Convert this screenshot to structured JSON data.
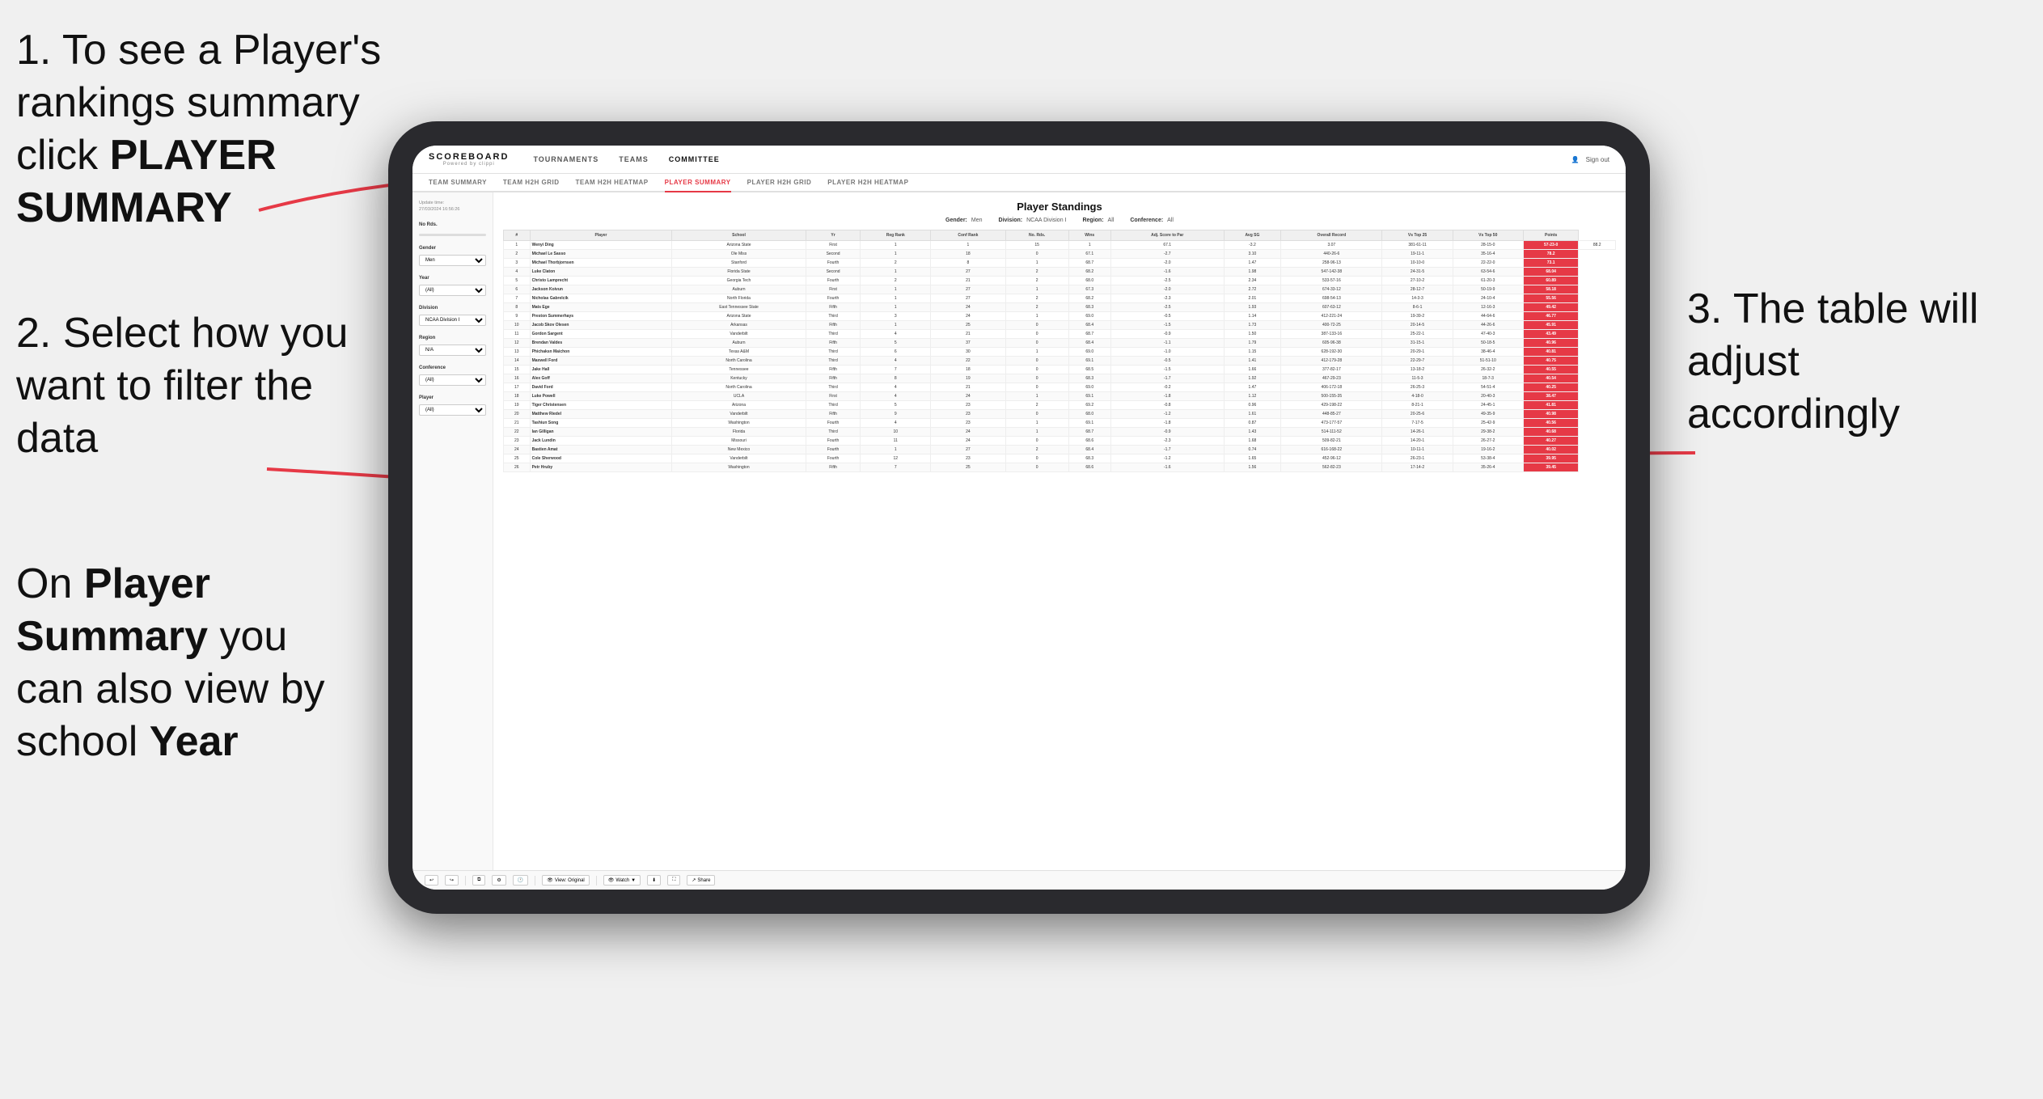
{
  "instructions": {
    "step1": {
      "text_prefix": "1. To see a Player's rankings summary click ",
      "bold_text": "PLAYER SUMMARY",
      "number": "1."
    },
    "step2": {
      "text": "2. Select how you want to filter the data"
    },
    "step3": {
      "text_prefix": "On ",
      "bold1": "Player Summary",
      "text_mid": " you can also view by school ",
      "bold2": "Year"
    },
    "step4": {
      "text": "3. The table will adjust accordingly"
    }
  },
  "app": {
    "logo": "SCOREBOARD",
    "logo_sub": "Powered by clippi",
    "nav": [
      "TOURNAMENTS",
      "TEAMS",
      "COMMITTEE"
    ],
    "nav_right": [
      "Sign out"
    ],
    "subnav": [
      "TEAM SUMMARY",
      "TEAM H2H GRID",
      "TEAM H2H HEATMAP",
      "PLAYER SUMMARY",
      "PLAYER H2H GRID",
      "PLAYER H2H HEATMAP"
    ],
    "active_subnav": "PLAYER SUMMARY"
  },
  "sidebar": {
    "update_label": "Update time:",
    "update_time": "27/03/2024 16:56:26",
    "no_rds_label": "No Rds.",
    "gender_label": "Gender",
    "gender_value": "Men",
    "year_label": "Year",
    "year_value": "(All)",
    "division_label": "Division",
    "division_value": "NCAA Division I",
    "region_label": "Region",
    "region_value": "N/A",
    "conference_label": "Conference",
    "conference_value": "(All)",
    "player_label": "Player",
    "player_value": "(All)"
  },
  "table": {
    "title": "Player Standings",
    "filters": {
      "gender_label": "Gender:",
      "gender_value": "Men",
      "division_label": "Division:",
      "division_value": "NCAA Division I",
      "region_label": "Region:",
      "region_value": "All",
      "conference_label": "Conference:",
      "conference_value": "All"
    },
    "columns": [
      "#",
      "Player",
      "School",
      "Yr",
      "Reg Rank",
      "Conf Rank",
      "No. Rds.",
      "Wins",
      "Adj. Score to Par",
      "Avg SG",
      "Overall Record",
      "Vs Top 25",
      "Vs Top 50",
      "Points"
    ],
    "rows": [
      [
        "1",
        "Wenyi Ding",
        "Arizona State",
        "First",
        "1",
        "1",
        "15",
        "1",
        "67.1",
        "-3.2",
        "3.07",
        "381-61-11",
        "28-15-0",
        "57-23-0",
        "88.2"
      ],
      [
        "2",
        "Michael Le Sasso",
        "Ole Miss",
        "Second",
        "1",
        "18",
        "0",
        "67.1",
        "-2.7",
        "3.10",
        "440-26-6",
        "19-11-1",
        "35-16-4",
        "78.2"
      ],
      [
        "3",
        "Michael Thorbjornsen",
        "Stanford",
        "Fourth",
        "2",
        "8",
        "1",
        "68.7",
        "-2.0",
        "1.47",
        "258-96-13",
        "10-10-0",
        "22-22-0",
        "73.1"
      ],
      [
        "4",
        "Luke Claton",
        "Florida State",
        "Second",
        "1",
        "27",
        "2",
        "68.2",
        "-1.6",
        "1.98",
        "547-142-38",
        "24-31-5",
        "63-54-6",
        "68.04"
      ],
      [
        "5",
        "Christo Lamprecht",
        "Georgia Tech",
        "Fourth",
        "2",
        "21",
        "2",
        "68.0",
        "-2.5",
        "2.34",
        "533-57-16",
        "27-10-2",
        "61-20-3",
        "60.89"
      ],
      [
        "6",
        "Jackson Koivun",
        "Auburn",
        "First",
        "1",
        "27",
        "1",
        "67.3",
        "-2.0",
        "2.72",
        "674-33-12",
        "28-12-7",
        "50-19-9",
        "58.18"
      ],
      [
        "7",
        "Nicholas Gabrelcik",
        "North Florida",
        "Fourth",
        "1",
        "27",
        "2",
        "68.2",
        "-2.3",
        "2.01",
        "698-54-13",
        "14-3-3",
        "24-10-4",
        "55.56"
      ],
      [
        "8",
        "Mats Ege",
        "East Tennessee State",
        "Fifth",
        "1",
        "24",
        "2",
        "68.3",
        "-2.5",
        "1.93",
        "607-63-12",
        "8-6-1",
        "12-16-3",
        "49.42"
      ],
      [
        "9",
        "Preston Summerhays",
        "Arizona State",
        "Third",
        "3",
        "24",
        "1",
        "69.0",
        "-0.5",
        "1.14",
        "412-221-24",
        "19-39-2",
        "44-64-6",
        "46.77"
      ],
      [
        "10",
        "Jacob Skov Olesen",
        "Arkansas",
        "Fifth",
        "1",
        "25",
        "0",
        "68.4",
        "-1.5",
        "1.73",
        "400-72-25",
        "20-14-5",
        "44-26-6",
        "45.91"
      ],
      [
        "11",
        "Gordon Sargent",
        "Vanderbilt",
        "Third",
        "4",
        "21",
        "0",
        "68.7",
        "-0.9",
        "1.50",
        "387-133-16",
        "25-22-1",
        "47-40-3",
        "43.49"
      ],
      [
        "12",
        "Brendan Valdes",
        "Auburn",
        "Fifth",
        "5",
        "37",
        "0",
        "68.4",
        "-1.1",
        "1.79",
        "605-96-38",
        "31-15-1",
        "50-18-5",
        "40.96"
      ],
      [
        "13",
        "Phichaksn Maichon",
        "Texas A&M",
        "Third",
        "6",
        "30",
        "1",
        "69.0",
        "-1.0",
        "1.15",
        "628-192-30",
        "20-29-1",
        "38-46-4",
        "40.81"
      ],
      [
        "14",
        "Maxwell Ford",
        "North Carolina",
        "Third",
        "4",
        "22",
        "0",
        "69.1",
        "-0.5",
        "1.41",
        "412-179-28",
        "22-29-7",
        "51-51-10",
        "40.75"
      ],
      [
        "15",
        "Jake Hall",
        "Tennessee",
        "Fifth",
        "7",
        "18",
        "0",
        "68.5",
        "-1.5",
        "1.66",
        "377-82-17",
        "13-18-2",
        "26-32-2",
        "40.55"
      ],
      [
        "16",
        "Alex Goff",
        "Kentucky",
        "Fifth",
        "8",
        "19",
        "0",
        "68.3",
        "-1.7",
        "1.92",
        "467-29-23",
        "11-5-3",
        "18-7-3",
        "40.54"
      ],
      [
        "17",
        "David Ford",
        "North Carolina",
        "Third",
        "4",
        "21",
        "0",
        "69.0",
        "-0.2",
        "1.47",
        "406-172-18",
        "26-25-3",
        "54-51-4",
        "40.25"
      ],
      [
        "18",
        "Luke Powell",
        "UCLA",
        "First",
        "4",
        "24",
        "1",
        "69.1",
        "-1.8",
        "1.12",
        "500-155-35",
        "4-18-0",
        "20-40-3",
        "38.47"
      ],
      [
        "19",
        "Tiger Christensen",
        "Arizona",
        "Third",
        "5",
        "23",
        "2",
        "69.2",
        "-0.8",
        "0.96",
        "429-198-22",
        "8-21-1",
        "24-45-1",
        "41.81"
      ],
      [
        "20",
        "Matthew Riedel",
        "Vanderbilt",
        "Fifth",
        "9",
        "23",
        "0",
        "68.0",
        "-1.2",
        "1.61",
        "448-85-27",
        "20-25-6",
        "49-35-9",
        "40.98"
      ],
      [
        "21",
        "Tashiun Song",
        "Washington",
        "Fourth",
        "4",
        "23",
        "1",
        "69.1",
        "-1.8",
        "0.87",
        "473-177-57",
        "7-17-5",
        "25-42-9",
        "40.56"
      ],
      [
        "22",
        "Ian Gilligan",
        "Florida",
        "Third",
        "10",
        "24",
        "1",
        "68.7",
        "-0.9",
        "1.43",
        "514-111-52",
        "14-26-1",
        "29-38-2",
        "40.68"
      ],
      [
        "23",
        "Jack Lundin",
        "Missouri",
        "Fourth",
        "11",
        "24",
        "0",
        "68.6",
        "-2.3",
        "1.68",
        "509-82-21",
        "14-20-1",
        "26-27-2",
        "40.27"
      ],
      [
        "24",
        "Bastien Amat",
        "New Mexico",
        "Fourth",
        "1",
        "27",
        "2",
        "68.4",
        "-1.7",
        "0.74",
        "616-168-22",
        "10-11-1",
        "19-16-2",
        "40.02"
      ],
      [
        "25",
        "Cole Sherwood",
        "Vanderbilt",
        "Fourth",
        "12",
        "23",
        "0",
        "68.3",
        "-1.2",
        "1.65",
        "452-96-12",
        "26-23-1",
        "53-38-4",
        "39.95"
      ],
      [
        "26",
        "Petr Hruby",
        "Washington",
        "Fifth",
        "7",
        "25",
        "0",
        "68.6",
        "-1.6",
        "1.56",
        "562-82-23",
        "17-14-2",
        "35-26-4",
        "39.45"
      ]
    ]
  },
  "toolbar": {
    "view_label": "View: Original",
    "watch_label": "Watch",
    "share_label": "Share"
  }
}
